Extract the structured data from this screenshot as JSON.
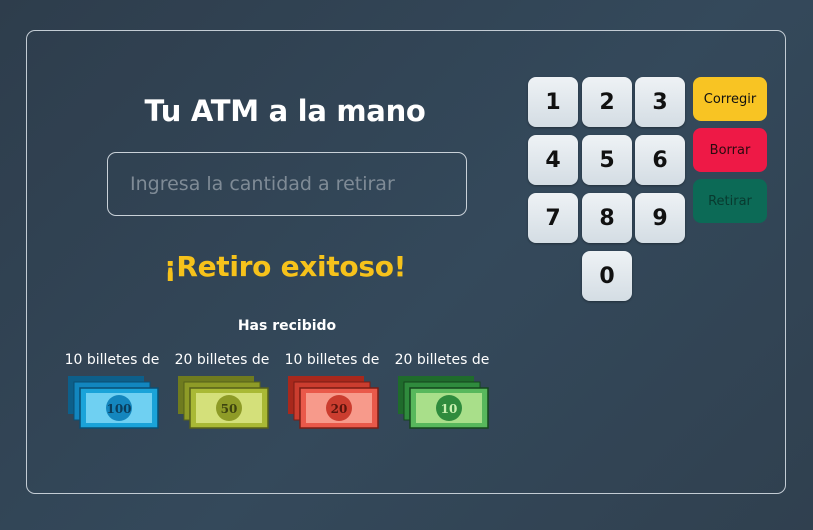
{
  "header": {
    "title": "Tu ATM a la mano"
  },
  "amount": {
    "placeholder": "Ingresa la cantidad a retirar",
    "value": ""
  },
  "result": {
    "message": "¡Retiro exitoso!",
    "received_label": "Has recibido",
    "bills": [
      {
        "caption": "10 billetes de",
        "denomination": "100",
        "color": "#1aa3d9"
      },
      {
        "caption": "20 billetes de",
        "denomination": "50",
        "color": "#a9b935"
      },
      {
        "caption": "10 billetes de",
        "denomination": "20",
        "color": "#e9594a"
      },
      {
        "caption": "20 billetes de",
        "denomination": "10",
        "color": "#58b85c"
      }
    ]
  },
  "keypad": {
    "keys": [
      "1",
      "2",
      "3",
      "4",
      "5",
      "6",
      "7",
      "8",
      "9",
      "0"
    ],
    "actions": {
      "correct": {
        "label": "Corregir",
        "color": "#f8c423"
      },
      "clear": {
        "label": "Borrar",
        "color": "#ee1946"
      },
      "withdraw": {
        "label": "Retirar",
        "color": "#0c6a56"
      }
    }
  }
}
